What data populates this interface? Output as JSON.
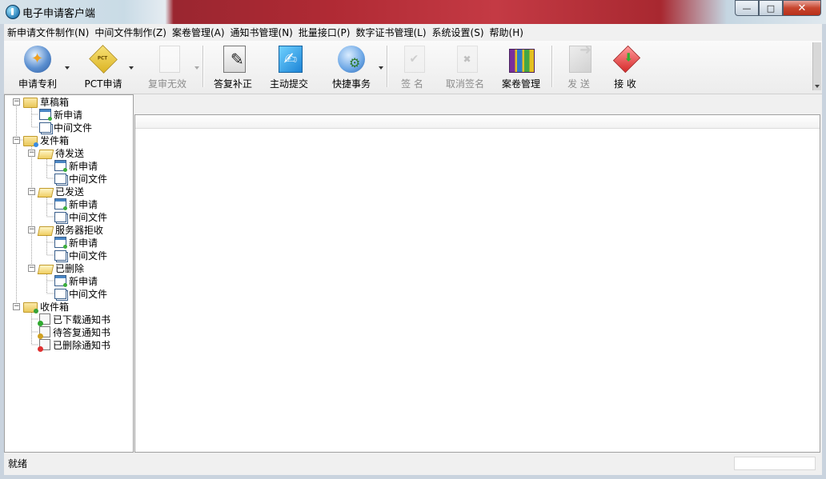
{
  "window": {
    "title": "电子申请客户端",
    "buttons": {
      "minimize": "—",
      "maximize": "□",
      "close": "✕"
    }
  },
  "menu": [
    "新申请文件制作(N)",
    "中间文件制作(Z)",
    "案卷管理(A)",
    "通知书管理(N)",
    "批量接口(P)",
    "数字证书管理(L)",
    "系统设置(S)",
    "帮助(H)"
  ],
  "toolbar": {
    "apply_patent": "申请专利",
    "pct_apply": "PCT申请",
    "reexam": "复审无效",
    "reply_correct": "答复补正",
    "active_submit": "主动提交",
    "quick_tasks": "快捷事务",
    "sign": "签 名",
    "cancel_sign": "取消签名",
    "case_mgmt": "案卷管理",
    "send": "发 送",
    "receive": "接 收"
  },
  "tree": {
    "draft": "草稿箱",
    "draft_new": "新申请",
    "draft_mid": "中间文件",
    "outbox": "发件箱",
    "pending": "待发送",
    "pending_new": "新申请",
    "pending_mid": "中间文件",
    "sent": "已发送",
    "sent_new": "新申请",
    "sent_mid": "中间文件",
    "rejected": "服务器拒收",
    "rejected_new": "新申请",
    "rejected_mid": "中间文件",
    "deleted": "已删除",
    "deleted_new": "新申请",
    "deleted_mid": "中间文件",
    "inbox": "收件箱",
    "downloaded": "已下载通知书",
    "to_reply": "待答复通知书",
    "deleted_notice": "已删除通知书"
  },
  "status": {
    "text": "就绪"
  }
}
